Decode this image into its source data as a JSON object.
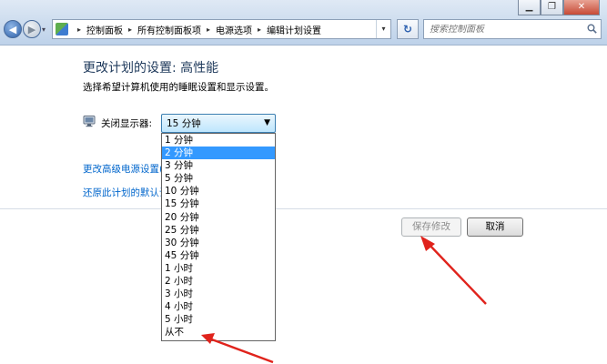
{
  "window": {
    "minimize_glyph": "▁",
    "maximize_glyph": "❐",
    "close_glyph": "✕"
  },
  "address_bar": {
    "breadcrumbs": [
      "控制面板",
      "所有控制面板项",
      "电源选项",
      "编辑计划设置"
    ],
    "separator_glyph": "▸",
    "dropdown_glyph": "▾",
    "refresh_glyph": "↻"
  },
  "search": {
    "placeholder": "搜索控制面板"
  },
  "page": {
    "title": "更改计划的设置: 高性能",
    "subtitle": "选择希望计算机使用的睡眠设置和显示设置。"
  },
  "display_setting": {
    "label": "关闭显示器:",
    "selected_value": "15 分钟",
    "arrow_glyph": "▼",
    "options": [
      "1 分钟",
      "2 分钟",
      "3 分钟",
      "5 分钟",
      "10 分钟",
      "15 分钟",
      "20 分钟",
      "25 分钟",
      "30 分钟",
      "45 分钟",
      "1 小时",
      "2 小时",
      "3 小时",
      "4 小时",
      "5 小时",
      "从不"
    ],
    "highlighted_index": 1
  },
  "links": {
    "advanced": "更改高级电源设置(C)",
    "restore": "还原此计划的默认设置"
  },
  "buttons": {
    "save": "保存修改",
    "cancel": "取消"
  },
  "colors": {
    "link": "#0066cc",
    "title": "#1e395b",
    "highlight": "#3399ff",
    "annotation_arrow": "#e0231c"
  }
}
